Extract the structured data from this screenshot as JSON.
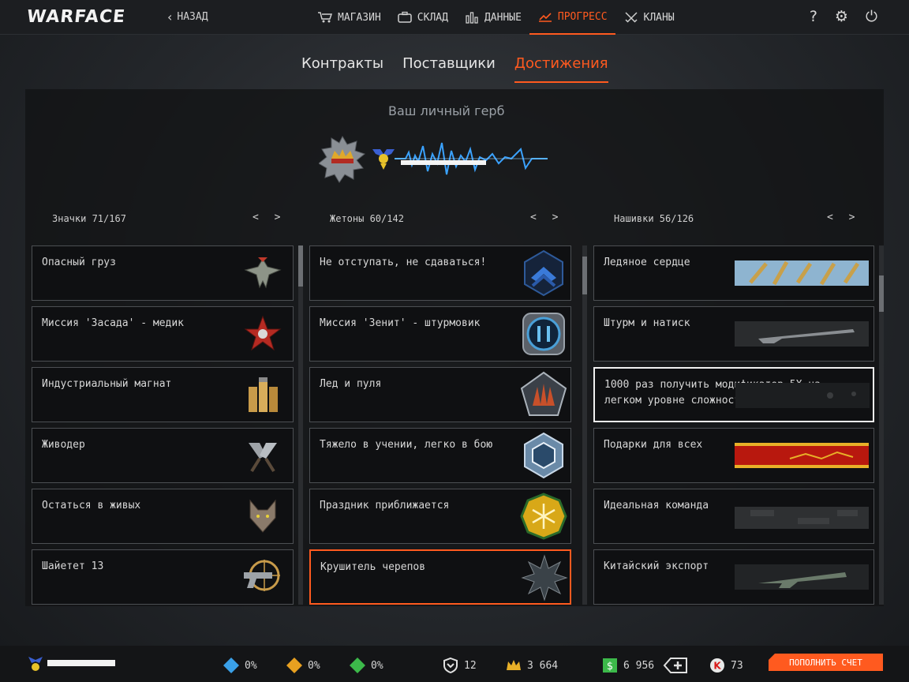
{
  "header": {
    "logo": "WARFACE",
    "back_label": "НАЗАД",
    "nav": [
      {
        "label": "МАГАЗИН",
        "icon": "cart-icon"
      },
      {
        "label": "СКЛАД",
        "icon": "briefcase-icon"
      },
      {
        "label": "ДАННЫЕ",
        "icon": "stats-icon"
      },
      {
        "label": "ПРОГРЕСС",
        "icon": "progress-chart-icon",
        "active": true
      },
      {
        "label": "КЛАНЫ",
        "icon": "crossed-swords-icon"
      }
    ],
    "icons": [
      "help-icon",
      "gear-icon",
      "power-icon"
    ],
    "accent_color": "#ff5a1f"
  },
  "subtabs": [
    {
      "label": "Контракты"
    },
    {
      "label": "Поставщики"
    },
    {
      "label": "Достижения",
      "active": true
    }
  ],
  "coat_of_arms": {
    "title": "Ваш личный герб"
  },
  "columns": [
    {
      "header": "Значки 71/167",
      "arrows": "< >",
      "items": [
        {
          "name": "Опасный груз",
          "icon": "eagle-badge-icon"
        },
        {
          "name": "Миссия 'Засада' - медик",
          "icon": "red-star-badge-icon"
        },
        {
          "name": "Индустриальный магнат",
          "icon": "ammo-shells-badge-icon"
        },
        {
          "name": "Живодер",
          "icon": "crossed-cleavers-badge-icon"
        },
        {
          "name": "Остаться в живых",
          "icon": "wolf-head-badge-icon"
        },
        {
          "name": "Шайетет 13",
          "icon": "pistol-crosshair-badge-icon"
        }
      ]
    },
    {
      "header": "Жетоны 60/142",
      "arrows": "< >",
      "items": [
        {
          "name": "Не отступать, не сдаваться!",
          "icon": "blue-chevron-token-icon"
        },
        {
          "name": "Миссия 'Зенит' - штурмовик",
          "icon": "blue-ring-token-icon"
        },
        {
          "name": "Лед и пуля",
          "icon": "pentagon-claw-token-icon"
        },
        {
          "name": "Тяжело в учении, легко в бою",
          "icon": "hexagon-snowflake-token-icon"
        },
        {
          "name": "Праздник приближается",
          "icon": "gold-snowflake-token-icon"
        },
        {
          "name": "Крушитель черепов",
          "icon": "dark-star-token-icon",
          "highlight": "orange"
        }
      ]
    },
    {
      "header": "Нашивки 56/126",
      "arrows": "< >",
      "items": [
        {
          "name": "Ледяное сердце",
          "icon": "ice-bullets-stripe-icon"
        },
        {
          "name": "Штурм и натиск",
          "icon": "rifle-stripe-icon"
        },
        {
          "name": "1000 раз получить модификатор 5X на легком уровне сложности",
          "icon": "dark-metal-stripe-icon",
          "highlight": "white"
        },
        {
          "name": "Подарки для всех",
          "icon": "red-gold-stripe-icon"
        },
        {
          "name": "Идеальная команда",
          "icon": "camo-stripe-icon"
        },
        {
          "name": "Китайский экспорт",
          "icon": "assault-rifle-stripe-icon"
        }
      ]
    }
  ],
  "footer": {
    "boosters": [
      {
        "value": "0%",
        "icon": "xp-booster-icon",
        "color": "#3aa0e8"
      },
      {
        "value": "0%",
        "icon": "vp-booster-icon",
        "color": "#e8a020"
      },
      {
        "value": "0%",
        "icon": "money-booster-icon",
        "color": "#3cb94a"
      }
    ],
    "currencies": [
      {
        "value": "12",
        "icon": "shield-heart-icon"
      },
      {
        "value": "3 664",
        "icon": "crown-icon"
      },
      {
        "value": "6 956",
        "icon": "dollar-icon"
      },
      {
        "value": "",
        "icon": "add-currency-icon"
      },
      {
        "value": "73",
        "icon": "kredit-icon"
      }
    ],
    "topup_label": "ПОПОЛНИТЬ СЧЕТ"
  }
}
